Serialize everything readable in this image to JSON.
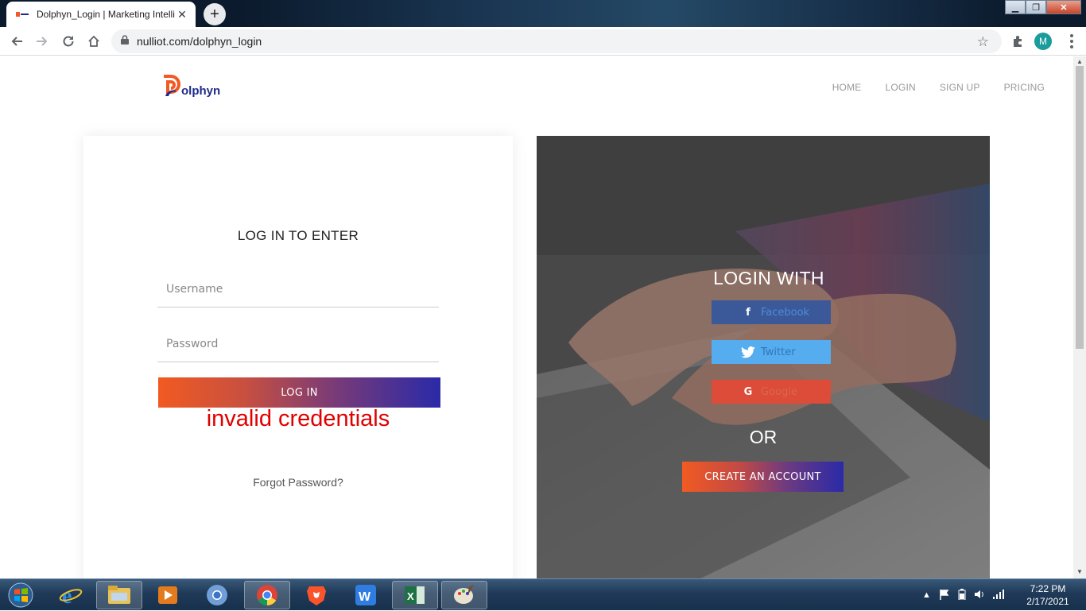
{
  "browser": {
    "tab_title": "Dolphyn_Login | Marketing Intelli",
    "tab_close": "✕",
    "new_tab": "+",
    "url": "nulliot.com/dolphyn_login",
    "profile_initial": "M",
    "window_controls": {
      "minimize": "▁",
      "maximize": "❐",
      "close": "✕"
    }
  },
  "site": {
    "logo_text": "olphyn",
    "nav": [
      "HOME",
      "LOGIN",
      "SIGN UP",
      "PRICING"
    ]
  },
  "login": {
    "title": "LOG IN TO ENTER",
    "username_placeholder": "Username",
    "password_placeholder": "Password",
    "login_button": "LOG IN",
    "error": "invalid credentials",
    "forgot": "Forgot Password?"
  },
  "social": {
    "heading": "LOGIN WITH",
    "facebook": "Facebook",
    "twitter": "Twitter",
    "google": "Google",
    "facebook_icon": "f",
    "google_icon": "G",
    "or": "OR",
    "create_account": "CREATE AN ACCOUNT"
  },
  "taskbar": {
    "time": "7:22 PM",
    "date": "2/17/2021"
  },
  "colors": {
    "facebook": "#3b5998",
    "twitter": "#55acee",
    "google": "#dd4b39",
    "error": "#e00000",
    "gradient_start": "#f15a22",
    "gradient_end": "#2a2aa8"
  }
}
